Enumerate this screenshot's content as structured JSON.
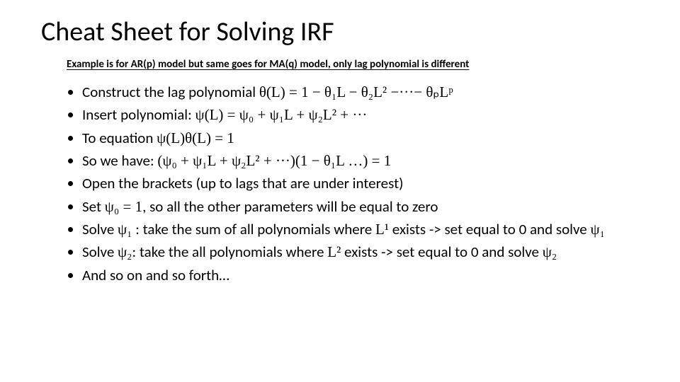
{
  "title": "Cheat Sheet for Solving IRF",
  "subtitle": "Example is for AR(p) model but same goes for MA(q) model, only lag polynomial is different",
  "bullets": {
    "b0a": "Construct the lag polynomial  ",
    "b0m": "θ(L) = 1 − θ₁L − θ₂L² −···− θₚLᵖ",
    "b1a": "Insert polynomial: ",
    "b1m": "ψ(L) = ψ₀ + ψ₁L + ψ₂L² + ···",
    "b2a": "To equation  ",
    "b2m": "ψ(L)θ(L) = 1",
    "b3a": "So we have: ",
    "b3m": "(ψ₀ + ψ₁L + ψ₂L² + ···)(1 − θ₁L   …) = 1",
    "b4": "Open the brackets (up to lags that are under interest)",
    "b5a": "Set ",
    "b5m": "ψ₀ = 1",
    "b5b": ", so all the other parameters will be equal to zero",
    "b6a": "Solve ",
    "b6m1": "ψ₁",
    "b6b": " : take the sum of all polynomials where ",
    "b6m2": "L¹",
    "b6c": " exists -> set equal to 0 and solve ",
    "b6m3": "ψ₁",
    "b7a": "Solve ",
    "b7m1": "ψ₂",
    "b7b": ": take the all polynomials where ",
    "b7m2": "L²",
    "b7c": " exists -> set equal to 0 and solve ",
    "b7m3": "ψ₂",
    "b8": "And so on and so forth…"
  }
}
